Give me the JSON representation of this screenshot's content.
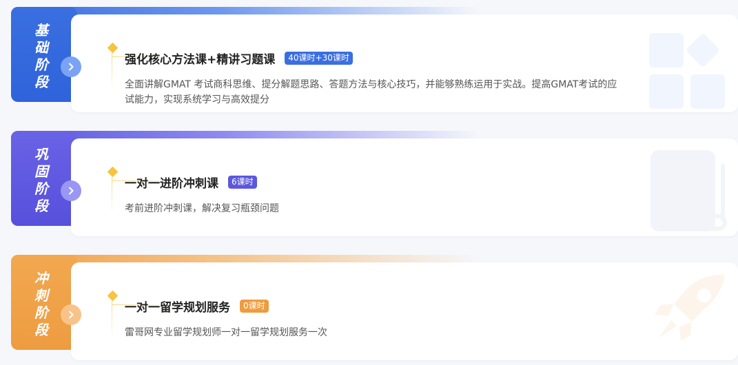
{
  "colors": {
    "blue": "#3a6fe0",
    "purple": "#5b57df",
    "orange": "#ee9c40",
    "accent_diamond": "#f8c33f"
  },
  "stages": [
    {
      "side_label": [
        "基",
        "础",
        "阶",
        "段"
      ],
      "title": "强化核心方法课+精讲习题课",
      "badge": "40课时+30课时",
      "description": "全面讲解GMAT 考试商科思维、提分解题思路、答题方法与核心技巧，并能够熟练运用于实战。提高GMAT考试的应试能力，实现系统学习与高效提分",
      "arrow_icon": "chevron-right-icon",
      "deco_icon": "grid-blocks-icon"
    },
    {
      "side_label": [
        "巩",
        "固",
        "阶",
        "段"
      ],
      "title": "一对一进阶冲刺课",
      "badge": "6课时",
      "description": "考前进阶冲刺课，解决复习瓶颈问题",
      "arrow_icon": "chevron-right-icon",
      "deco_icon": "book-icon"
    },
    {
      "side_label": [
        "冲",
        "刺",
        "阶",
        "段"
      ],
      "title": "一对一留学规划服务",
      "badge": "0课时",
      "description": "雷哥网专业留学规划师一对一留学规划服务一次",
      "arrow_icon": "chevron-right-icon",
      "deco_icon": "rocket-icon"
    }
  ]
}
